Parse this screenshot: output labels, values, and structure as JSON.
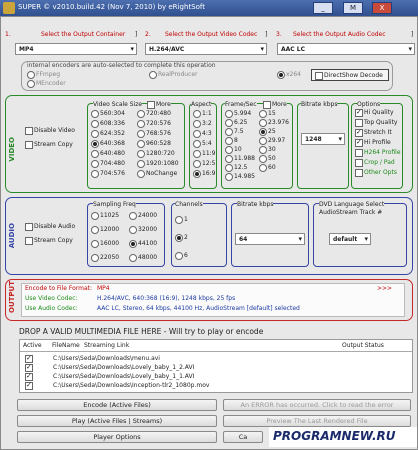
{
  "window": {
    "title": "SUPER © v2010.build.42 (Nov 7, 2010) by eRightSoft",
    "minimize": "_",
    "restore": "M",
    "close": "X"
  },
  "containers": {
    "output": {
      "label": "1.",
      "title": "Select the Output Container",
      "value": "MP4",
      "end": "]"
    },
    "video": {
      "label": "2.",
      "title": "Select the Output Video Codec",
      "value": "H.264/AVC",
      "end": "]"
    },
    "audio": {
      "label": "3.",
      "title": "Select the Output Audio Codec",
      "value": "AAC LC",
      "end": "]"
    }
  },
  "encoders": {
    "note": "internal encoders are auto-selected to complete this operation",
    "ffmpeg": "FFmpeg",
    "mencoder": "MEncoder",
    "realproducer": "RealProducer",
    "x264": "x264",
    "directshow": "DirectShow Decode"
  },
  "video": {
    "section": "VIDEO",
    "disable": "Disable Video",
    "stream_copy": "Stream Copy",
    "scale_title": "Video Scale Size",
    "more": "More",
    "scale_col1": [
      "560:304",
      "608:336",
      "624:352",
      "640:368",
      "640:480",
      "704:480",
      "704:576"
    ],
    "scale_col2": [
      "720:480",
      "720:576",
      "768:576",
      "960:528",
      "1280:720",
      "1920:1080",
      "NoChange"
    ],
    "aspect_title": "Aspect",
    "aspect": [
      "1:1",
      "3:2",
      "4:3",
      "5:4",
      "11:9",
      "12:5",
      "16:9"
    ],
    "fps_title": "Frame/Sec",
    "fps_col1": [
      "5.994",
      "6.25",
      "7.5",
      "8",
      "10",
      "11.988",
      "12.5",
      "14.985"
    ],
    "fps_col2": [
      "15",
      "23.976",
      "25",
      "29.97",
      "30",
      "50",
      "60"
    ],
    "bitrate_title": "Bitrate  kbps",
    "bitrate": "1248",
    "options_title": "Options",
    "options": [
      "Hi Quality",
      "Top Quality",
      "Stretch It",
      "Hi Profile",
      "H264 Profile",
      "Crop / Pad",
      "Other Opts"
    ]
  },
  "audio": {
    "section": "AUDIO",
    "disable": "Disable Audio",
    "stream_copy": "Stream Copy",
    "freq_title": "Sampling Freq",
    "freq_col1": [
      "11025",
      "12000",
      "16000",
      "22050"
    ],
    "freq_col2": [
      "24000",
      "32000",
      "44100",
      "48000"
    ],
    "channels_title": "Channels",
    "channels": [
      "1",
      "2",
      "6"
    ],
    "bitrate_title": "Bitrate  kbps",
    "bitrate": "64",
    "dvd_title": "DVD Language Select",
    "dvd_sub": "AudioStream  Track #",
    "dvd_value": "default"
  },
  "output": {
    "section": "OUTPUT",
    "format_label": "Encode to File Format:",
    "format_value": "MP4",
    "arrows": ">>>",
    "video_label": "Use Video Codec:",
    "video_value": "H.264/AVC,  640:368 (16:9),  1248 kbps,  25 fps",
    "audio_label": "Use Audio Codec:",
    "audio_value": "AAC LC,  Stereo,  64 kbps,  44100 Hz,  AudioStream [default] selected"
  },
  "drop_text": "DROP A VALID MULTIMEDIA FILE HERE - Will try to play or encode",
  "files": {
    "columns": {
      "active": "Active",
      "filename": "FileName",
      "streaming": "Streaming Link",
      "status": "Output Status"
    },
    "rows": [
      {
        "name": "C:\\Users\\Seda\\Downloads\\menu.avi"
      },
      {
        "name": "C:\\Users\\Seda\\Downloads\\Lovely_baby_1_2.AVI"
      },
      {
        "name": "C:\\Users\\Seda\\Downloads\\Lovely_baby_1_1.AVI"
      },
      {
        "name": "C:\\Users\\Seda\\Downloads\\Inception-tlr2_1080p.mov"
      }
    ]
  },
  "buttons": {
    "encode": "Encode (Active Files)",
    "play": "Play (Active Files | Streams)",
    "player_options": "Player Options",
    "error": "An ERROR has occurred. Click to read the error",
    "preview": "Preview The Last Rendered File",
    "cancel": "Ca"
  },
  "watermark": "PROGRAMNEW.RU",
  "colors": {
    "titlebar": "#3a5b9c",
    "video": "#2a8a2a",
    "audio": "#3545a6",
    "output": "#c62828",
    "red_text": "#c00000",
    "green_text": "#1a8a1a"
  }
}
